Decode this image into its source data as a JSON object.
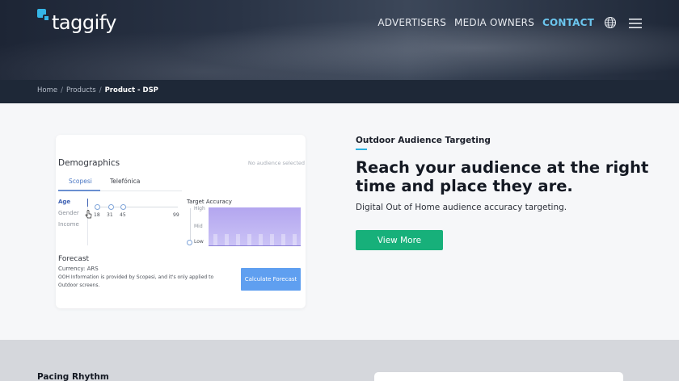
{
  "header": {
    "logo_text": "taggify",
    "nav": [
      "ADVERTISERS",
      "MEDIA OWNERS",
      "CONTACT"
    ],
    "active_nav": "CONTACT",
    "icons": [
      "globe-icon",
      "hamburger-menu-icon"
    ]
  },
  "breadcrumb": {
    "home": "Home",
    "products": "Products",
    "current": "Product - DSP",
    "separator": "/"
  },
  "demo_card": {
    "title": "Demographics",
    "note": "No audience selected",
    "tabs": [
      "Scopesi",
      "Telefónica"
    ],
    "filters": [
      "Age",
      "Gender",
      "Income"
    ],
    "age_ticks": [
      "18",
      "31",
      "45",
      "99"
    ],
    "target_accuracy": {
      "title": "Target Accuracy",
      "levels": [
        "High",
        "Mid",
        "Low"
      ]
    },
    "forecast": {
      "title": "Forecast",
      "currency": "Currency: ARS",
      "info": "OOH Information is provided by Scopesi, and it's only applied to Outdoor screens.",
      "button": "Calculate Forecast"
    }
  },
  "hero": {
    "eyebrow": "Outdoor Audience Targeting",
    "headline": "Reach your audience at the right time and place they are.",
    "subtext": "Digital Out of Home audience accuracy targeting.",
    "cta": "View More"
  },
  "next_section": {
    "title": "Pacing Rhythm"
  },
  "colors": {
    "accent": "#2ab0df",
    "cta_green": "#17b07a",
    "calc_blue": "#5f9ff0",
    "header_dark": "#1e2837"
  }
}
